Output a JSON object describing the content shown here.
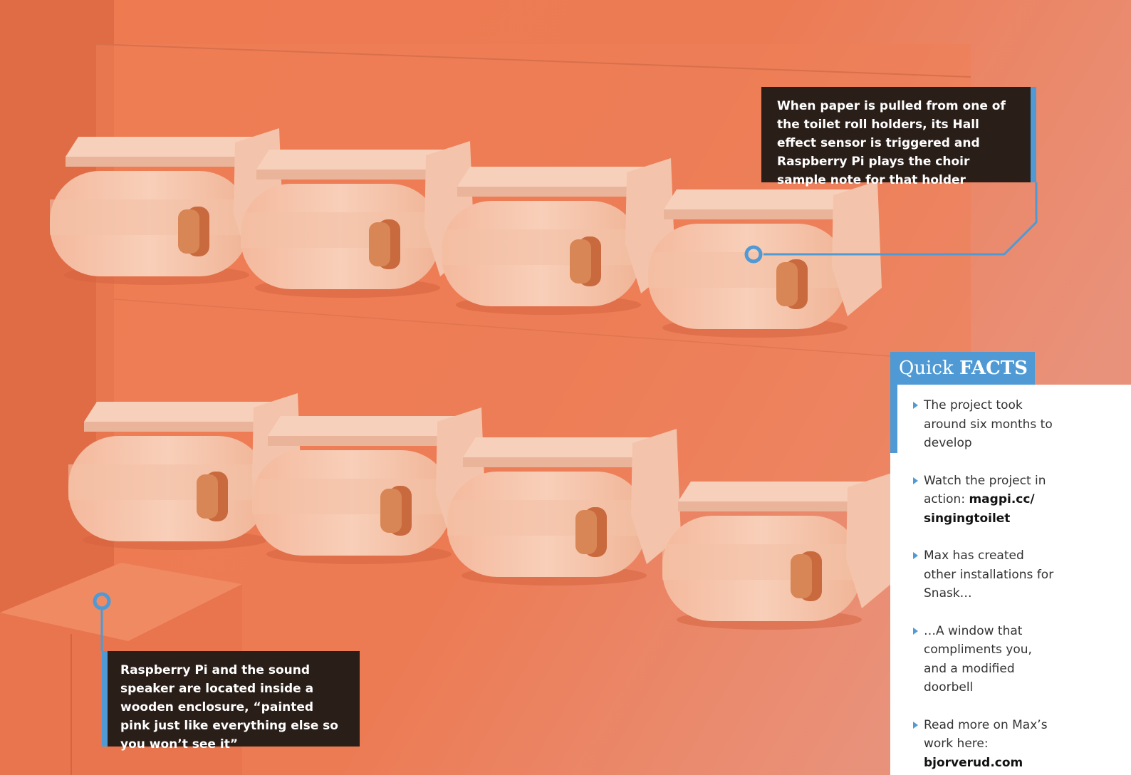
{
  "captions": {
    "top": "When paper is pulled from one of the toilet roll holders, its Hall effect sensor is triggered and Raspberry Pi plays the choir sample note for that holder",
    "bottom": "Raspberry Pi and the sound speaker are located inside a wooden enclosure, “painted pink just like everything else so you won’t see it”"
  },
  "quick_facts": {
    "title_light": "Quick",
    "title_bold": "FACTS",
    "items": [
      {
        "text": "The project took around six months to develop",
        "link": ""
      },
      {
        "text": "Watch the project in action: ",
        "link": "magpi.cc/ singingtoilet"
      },
      {
        "text": "Max has created other installations for Snask…",
        "link": ""
      },
      {
        "text": "…A window that compliments you, and a modified doorbell",
        "link": ""
      },
      {
        "text": "Read more on Max’s work here: ",
        "link": "bjorverud.com"
      }
    ]
  },
  "colors": {
    "wall": "#e8764e",
    "accent": "#4f9ad5",
    "caption_bg": "#2a1e18",
    "paper": "#f6cbb3"
  },
  "icons": [
    "callout-marker-icon",
    "bullet-arrow-icon"
  ]
}
